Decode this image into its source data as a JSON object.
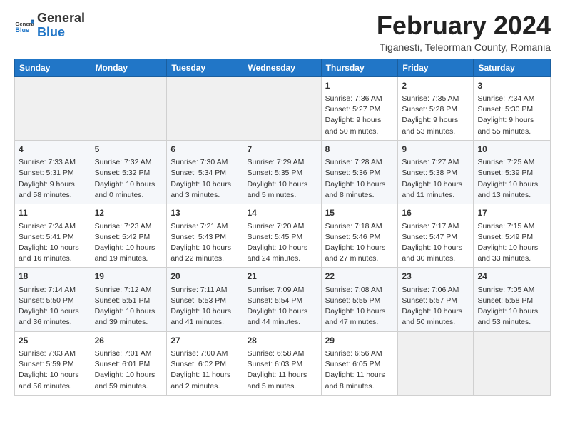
{
  "header": {
    "logo_general": "General",
    "logo_blue": "Blue",
    "month_title": "February 2024",
    "location": "Tiganesti, Teleorman County, Romania"
  },
  "weekdays": [
    "Sunday",
    "Monday",
    "Tuesday",
    "Wednesday",
    "Thursday",
    "Friday",
    "Saturday"
  ],
  "weeks": [
    [
      {
        "day": "",
        "info": ""
      },
      {
        "day": "",
        "info": ""
      },
      {
        "day": "",
        "info": ""
      },
      {
        "day": "",
        "info": ""
      },
      {
        "day": "1",
        "info": "Sunrise: 7:36 AM\nSunset: 5:27 PM\nDaylight: 9 hours\nand 50 minutes."
      },
      {
        "day": "2",
        "info": "Sunrise: 7:35 AM\nSunset: 5:28 PM\nDaylight: 9 hours\nand 53 minutes."
      },
      {
        "day": "3",
        "info": "Sunrise: 7:34 AM\nSunset: 5:30 PM\nDaylight: 9 hours\nand 55 minutes."
      }
    ],
    [
      {
        "day": "4",
        "info": "Sunrise: 7:33 AM\nSunset: 5:31 PM\nDaylight: 9 hours\nand 58 minutes."
      },
      {
        "day": "5",
        "info": "Sunrise: 7:32 AM\nSunset: 5:32 PM\nDaylight: 10 hours\nand 0 minutes."
      },
      {
        "day": "6",
        "info": "Sunrise: 7:30 AM\nSunset: 5:34 PM\nDaylight: 10 hours\nand 3 minutes."
      },
      {
        "day": "7",
        "info": "Sunrise: 7:29 AM\nSunset: 5:35 PM\nDaylight: 10 hours\nand 5 minutes."
      },
      {
        "day": "8",
        "info": "Sunrise: 7:28 AM\nSunset: 5:36 PM\nDaylight: 10 hours\nand 8 minutes."
      },
      {
        "day": "9",
        "info": "Sunrise: 7:27 AM\nSunset: 5:38 PM\nDaylight: 10 hours\nand 11 minutes."
      },
      {
        "day": "10",
        "info": "Sunrise: 7:25 AM\nSunset: 5:39 PM\nDaylight: 10 hours\nand 13 minutes."
      }
    ],
    [
      {
        "day": "11",
        "info": "Sunrise: 7:24 AM\nSunset: 5:41 PM\nDaylight: 10 hours\nand 16 minutes."
      },
      {
        "day": "12",
        "info": "Sunrise: 7:23 AM\nSunset: 5:42 PM\nDaylight: 10 hours\nand 19 minutes."
      },
      {
        "day": "13",
        "info": "Sunrise: 7:21 AM\nSunset: 5:43 PM\nDaylight: 10 hours\nand 22 minutes."
      },
      {
        "day": "14",
        "info": "Sunrise: 7:20 AM\nSunset: 5:45 PM\nDaylight: 10 hours\nand 24 minutes."
      },
      {
        "day": "15",
        "info": "Sunrise: 7:18 AM\nSunset: 5:46 PM\nDaylight: 10 hours\nand 27 minutes."
      },
      {
        "day": "16",
        "info": "Sunrise: 7:17 AM\nSunset: 5:47 PM\nDaylight: 10 hours\nand 30 minutes."
      },
      {
        "day": "17",
        "info": "Sunrise: 7:15 AM\nSunset: 5:49 PM\nDaylight: 10 hours\nand 33 minutes."
      }
    ],
    [
      {
        "day": "18",
        "info": "Sunrise: 7:14 AM\nSunset: 5:50 PM\nDaylight: 10 hours\nand 36 minutes."
      },
      {
        "day": "19",
        "info": "Sunrise: 7:12 AM\nSunset: 5:51 PM\nDaylight: 10 hours\nand 39 minutes."
      },
      {
        "day": "20",
        "info": "Sunrise: 7:11 AM\nSunset: 5:53 PM\nDaylight: 10 hours\nand 41 minutes."
      },
      {
        "day": "21",
        "info": "Sunrise: 7:09 AM\nSunset: 5:54 PM\nDaylight: 10 hours\nand 44 minutes."
      },
      {
        "day": "22",
        "info": "Sunrise: 7:08 AM\nSunset: 5:55 PM\nDaylight: 10 hours\nand 47 minutes."
      },
      {
        "day": "23",
        "info": "Sunrise: 7:06 AM\nSunset: 5:57 PM\nDaylight: 10 hours\nand 50 minutes."
      },
      {
        "day": "24",
        "info": "Sunrise: 7:05 AM\nSunset: 5:58 PM\nDaylight: 10 hours\nand 53 minutes."
      }
    ],
    [
      {
        "day": "25",
        "info": "Sunrise: 7:03 AM\nSunset: 5:59 PM\nDaylight: 10 hours\nand 56 minutes."
      },
      {
        "day": "26",
        "info": "Sunrise: 7:01 AM\nSunset: 6:01 PM\nDaylight: 10 hours\nand 59 minutes."
      },
      {
        "day": "27",
        "info": "Sunrise: 7:00 AM\nSunset: 6:02 PM\nDaylight: 11 hours\nand 2 minutes."
      },
      {
        "day": "28",
        "info": "Sunrise: 6:58 AM\nSunset: 6:03 PM\nDaylight: 11 hours\nand 5 minutes."
      },
      {
        "day": "29",
        "info": "Sunrise: 6:56 AM\nSunset: 6:05 PM\nDaylight: 11 hours\nand 8 minutes."
      },
      {
        "day": "",
        "info": ""
      },
      {
        "day": "",
        "info": ""
      }
    ]
  ]
}
